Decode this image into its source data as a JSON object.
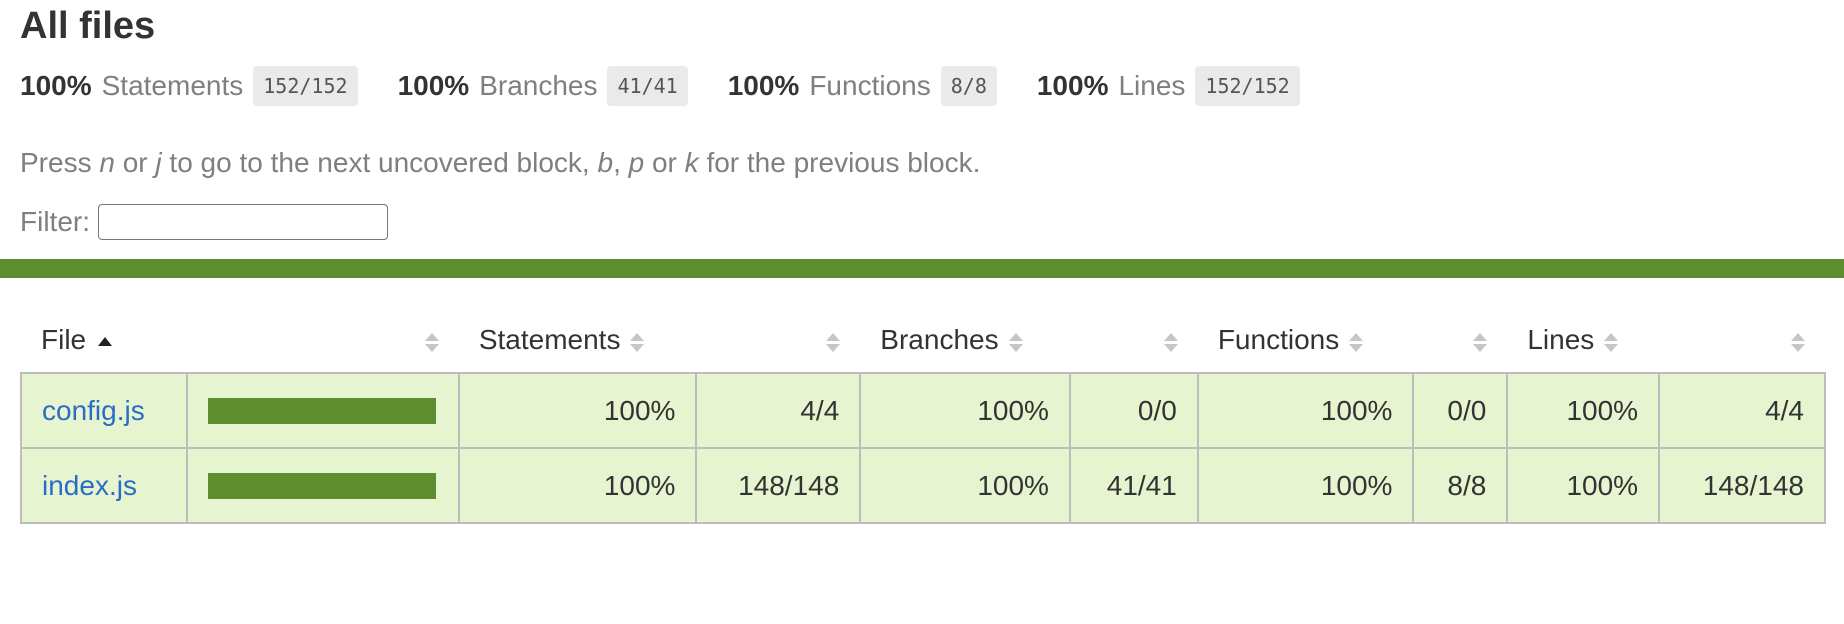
{
  "page": {
    "title": "All files"
  },
  "summary": [
    {
      "pct": "100%",
      "label": "Statements",
      "fraction": "152/152"
    },
    {
      "pct": "100%",
      "label": "Branches",
      "fraction": "41/41"
    },
    {
      "pct": "100%",
      "label": "Functions",
      "fraction": "8/8"
    },
    {
      "pct": "100%",
      "label": "Lines",
      "fraction": "152/152"
    }
  ],
  "hint": {
    "t1": "Press ",
    "k1": "n",
    "t2": " or ",
    "k2": "j",
    "t3": " to go to the next uncovered block, ",
    "k3": "b",
    "t4": ", ",
    "k4": "p",
    "t5": " or ",
    "k5": "k",
    "t6": " for the previous block."
  },
  "filter": {
    "label": "Filter:",
    "value": "",
    "placeholder": ""
  },
  "table": {
    "headers": {
      "file": "File",
      "statements": "Statements",
      "branches": "Branches",
      "functions": "Functions",
      "lines": "Lines"
    },
    "rows": [
      {
        "file": "config.js",
        "coverage": 1.0,
        "stmt_pct": "100%",
        "stmt": "4/4",
        "br_pct": "100%",
        "br": "0/0",
        "fn_pct": "100%",
        "fn": "0/0",
        "ln_pct": "100%",
        "ln": "4/4"
      },
      {
        "file": "index.js",
        "coverage": 1.0,
        "stmt_pct": "100%",
        "stmt": "148/148",
        "br_pct": "100%",
        "br": "41/41",
        "fn_pct": "100%",
        "fn": "8/8",
        "ln_pct": "100%",
        "ln": "148/148"
      }
    ]
  },
  "colors": {
    "high_bg": "#e6f5d0",
    "high_bar": "#5e8d2f",
    "link": "#2a6cc6"
  }
}
